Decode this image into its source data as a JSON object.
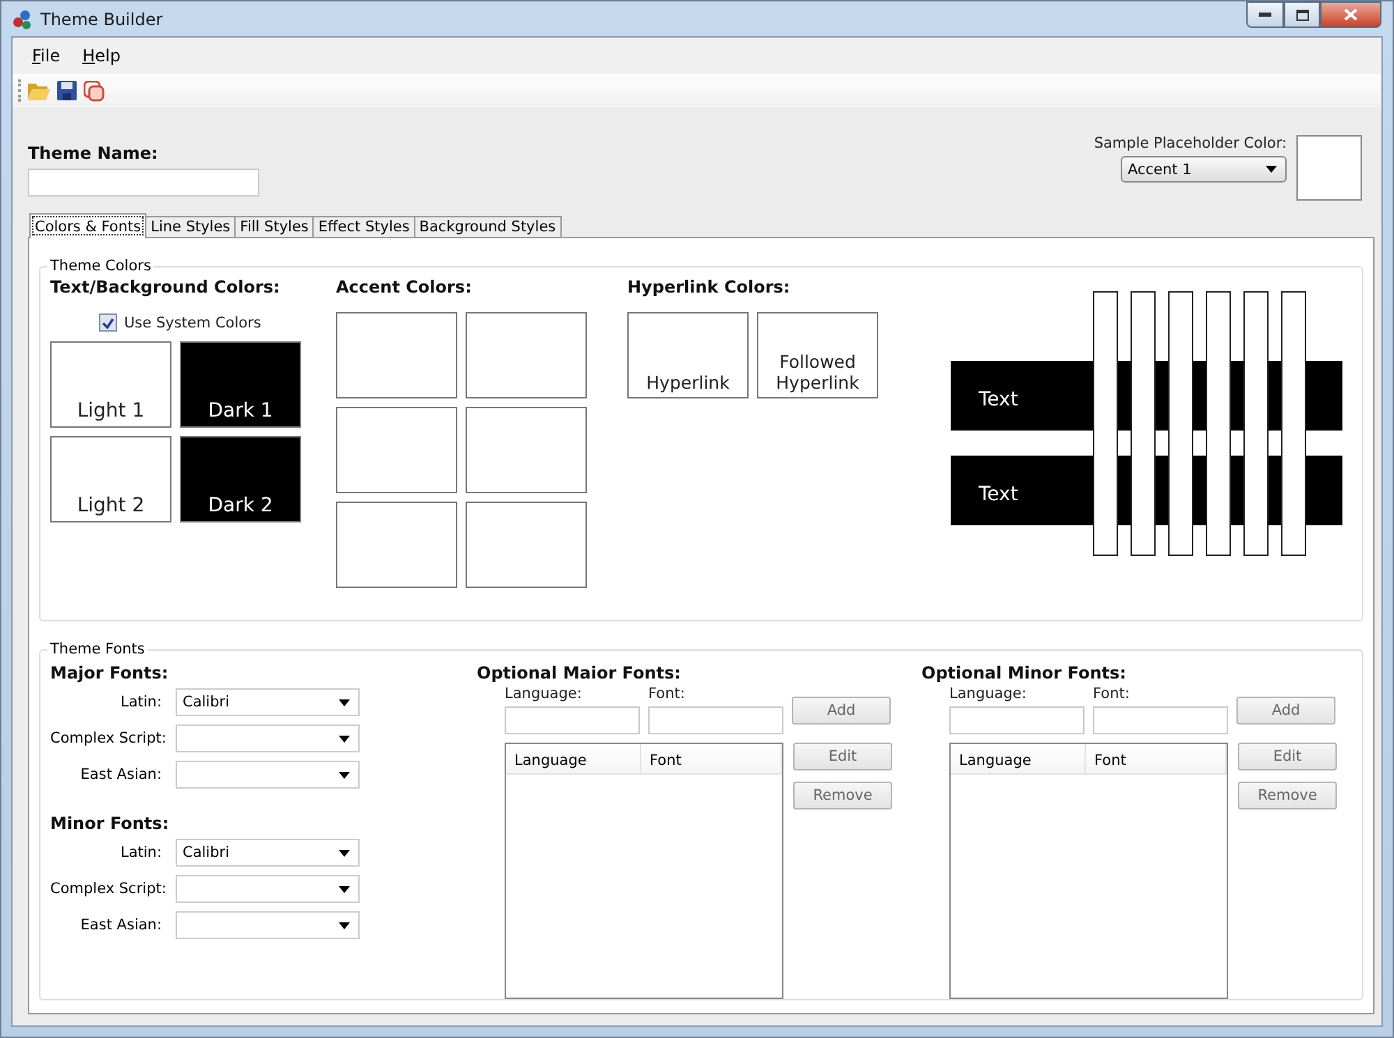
{
  "window": {
    "title": "Theme Builder"
  },
  "menu": [
    {
      "label": "File"
    },
    {
      "label": "Help"
    }
  ],
  "theme_name": {
    "label": "Theme Name:"
  },
  "sample_placeholder": {
    "label": "Sample Placeholder Color:",
    "value": "Accent 1",
    "color": "#ffffff"
  },
  "tabs": [
    {
      "label": "Colors & Fonts",
      "selected": true
    },
    {
      "label": "Line Styles",
      "selected": false
    },
    {
      "label": "Fill Styles",
      "selected": false
    },
    {
      "label": "Effect Styles",
      "selected": false
    },
    {
      "label": "Background Styles",
      "selected": false
    }
  ],
  "theme_colors": {
    "title": "Theme Colors",
    "text_background": {
      "heading": "Text/Background Colors:",
      "use_system_colors": {
        "label": "Use System Colors",
        "checked": true
      },
      "swatches": [
        {
          "label": "Light 1",
          "color": "#ffffff"
        },
        {
          "label": "Dark 1",
          "color": "#000000"
        },
        {
          "label": "Light 2",
          "color": "#ffffff"
        },
        {
          "label": "Dark 2",
          "color": "#000000"
        }
      ]
    },
    "accent": {
      "heading": "Accent Colors:",
      "swatches": [
        {
          "color": "#ffffff"
        },
        {
          "color": "#ffffff"
        },
        {
          "color": "#ffffff"
        },
        {
          "color": "#ffffff"
        },
        {
          "color": "#ffffff"
        },
        {
          "color": "#ffffff"
        }
      ]
    },
    "hyperlink": {
      "heading": "Hyperlink Colors:",
      "swatches": [
        {
          "label": "Hyperlink",
          "color": "#ffffff"
        },
        {
          "label": "Followed Hyperlink",
          "color": "#ffffff"
        }
      ]
    },
    "preview": {
      "texts": [
        "Text",
        "Text"
      ]
    }
  },
  "theme_fonts": {
    "title": "Theme Fonts",
    "major": {
      "heading": "Major Fonts:",
      "rows": [
        {
          "label": "Latin:",
          "value": "Calibri"
        },
        {
          "label": "Complex Script:"
        },
        {
          "label": "East Asian:"
        }
      ]
    },
    "minor": {
      "heading": "Minor Fonts:",
      "rows": [
        {
          "label": "Latin:",
          "value": "Calibri"
        },
        {
          "label": "Complex Script:"
        },
        {
          "label": "East Asian:"
        }
      ]
    },
    "optional_major": {
      "heading": "Optional Maior Fonts:",
      "language_label": "Language:",
      "font_label": "Font:",
      "columns": [
        "Language",
        "Font"
      ],
      "buttons": [
        "Add",
        "Edit",
        "Remove"
      ]
    },
    "optional_minor": {
      "heading": "Optional Minor Fonts:",
      "language_label": "Language:",
      "font_label": "Font:",
      "columns": [
        "Language",
        "Font"
      ],
      "buttons": [
        "Add",
        "Edit",
        "Remove"
      ]
    }
  }
}
